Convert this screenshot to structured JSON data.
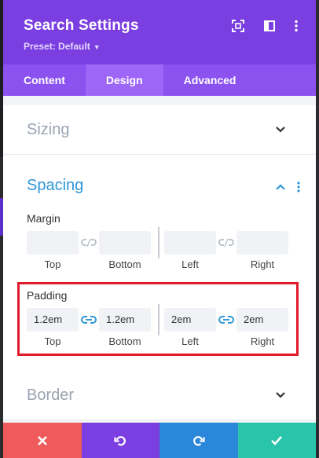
{
  "header": {
    "title": "Search Settings",
    "preset": "Preset: Default"
  },
  "tabs": [
    {
      "label": "Content",
      "active": false
    },
    {
      "label": "Design",
      "active": true
    },
    {
      "label": "Advanced",
      "active": false
    }
  ],
  "sections": {
    "sizing": "Sizing",
    "spacing": "Spacing",
    "border": "Border"
  },
  "margin": {
    "label": "Margin",
    "top": {
      "label": "Top",
      "value": ""
    },
    "bottom": {
      "label": "Bottom",
      "value": ""
    },
    "left": {
      "label": "Left",
      "value": ""
    },
    "right": {
      "label": "Right",
      "value": ""
    }
  },
  "padding": {
    "label": "Padding",
    "top": {
      "label": "Top",
      "value": "1.2em"
    },
    "bottom": {
      "label": "Bottom",
      "value": "1.2em"
    },
    "left": {
      "label": "Left",
      "value": "2em"
    },
    "right": {
      "label": "Right",
      "value": "2em"
    }
  },
  "colors": {
    "header": "#7b3ee0",
    "tabs": "#8b52f0",
    "accent": "#2e97d8",
    "highlight": "#e21a2a",
    "discard": "#ef5b5b",
    "undo": "#7b3ee0",
    "redo": "#2b87da",
    "save": "#29c4a9"
  },
  "icons": {
    "header": [
      "expand-icon",
      "columns-icon",
      "more-vertical-icon"
    ],
    "footer": [
      "close-icon",
      "undo-icon",
      "redo-icon",
      "check-icon"
    ]
  }
}
